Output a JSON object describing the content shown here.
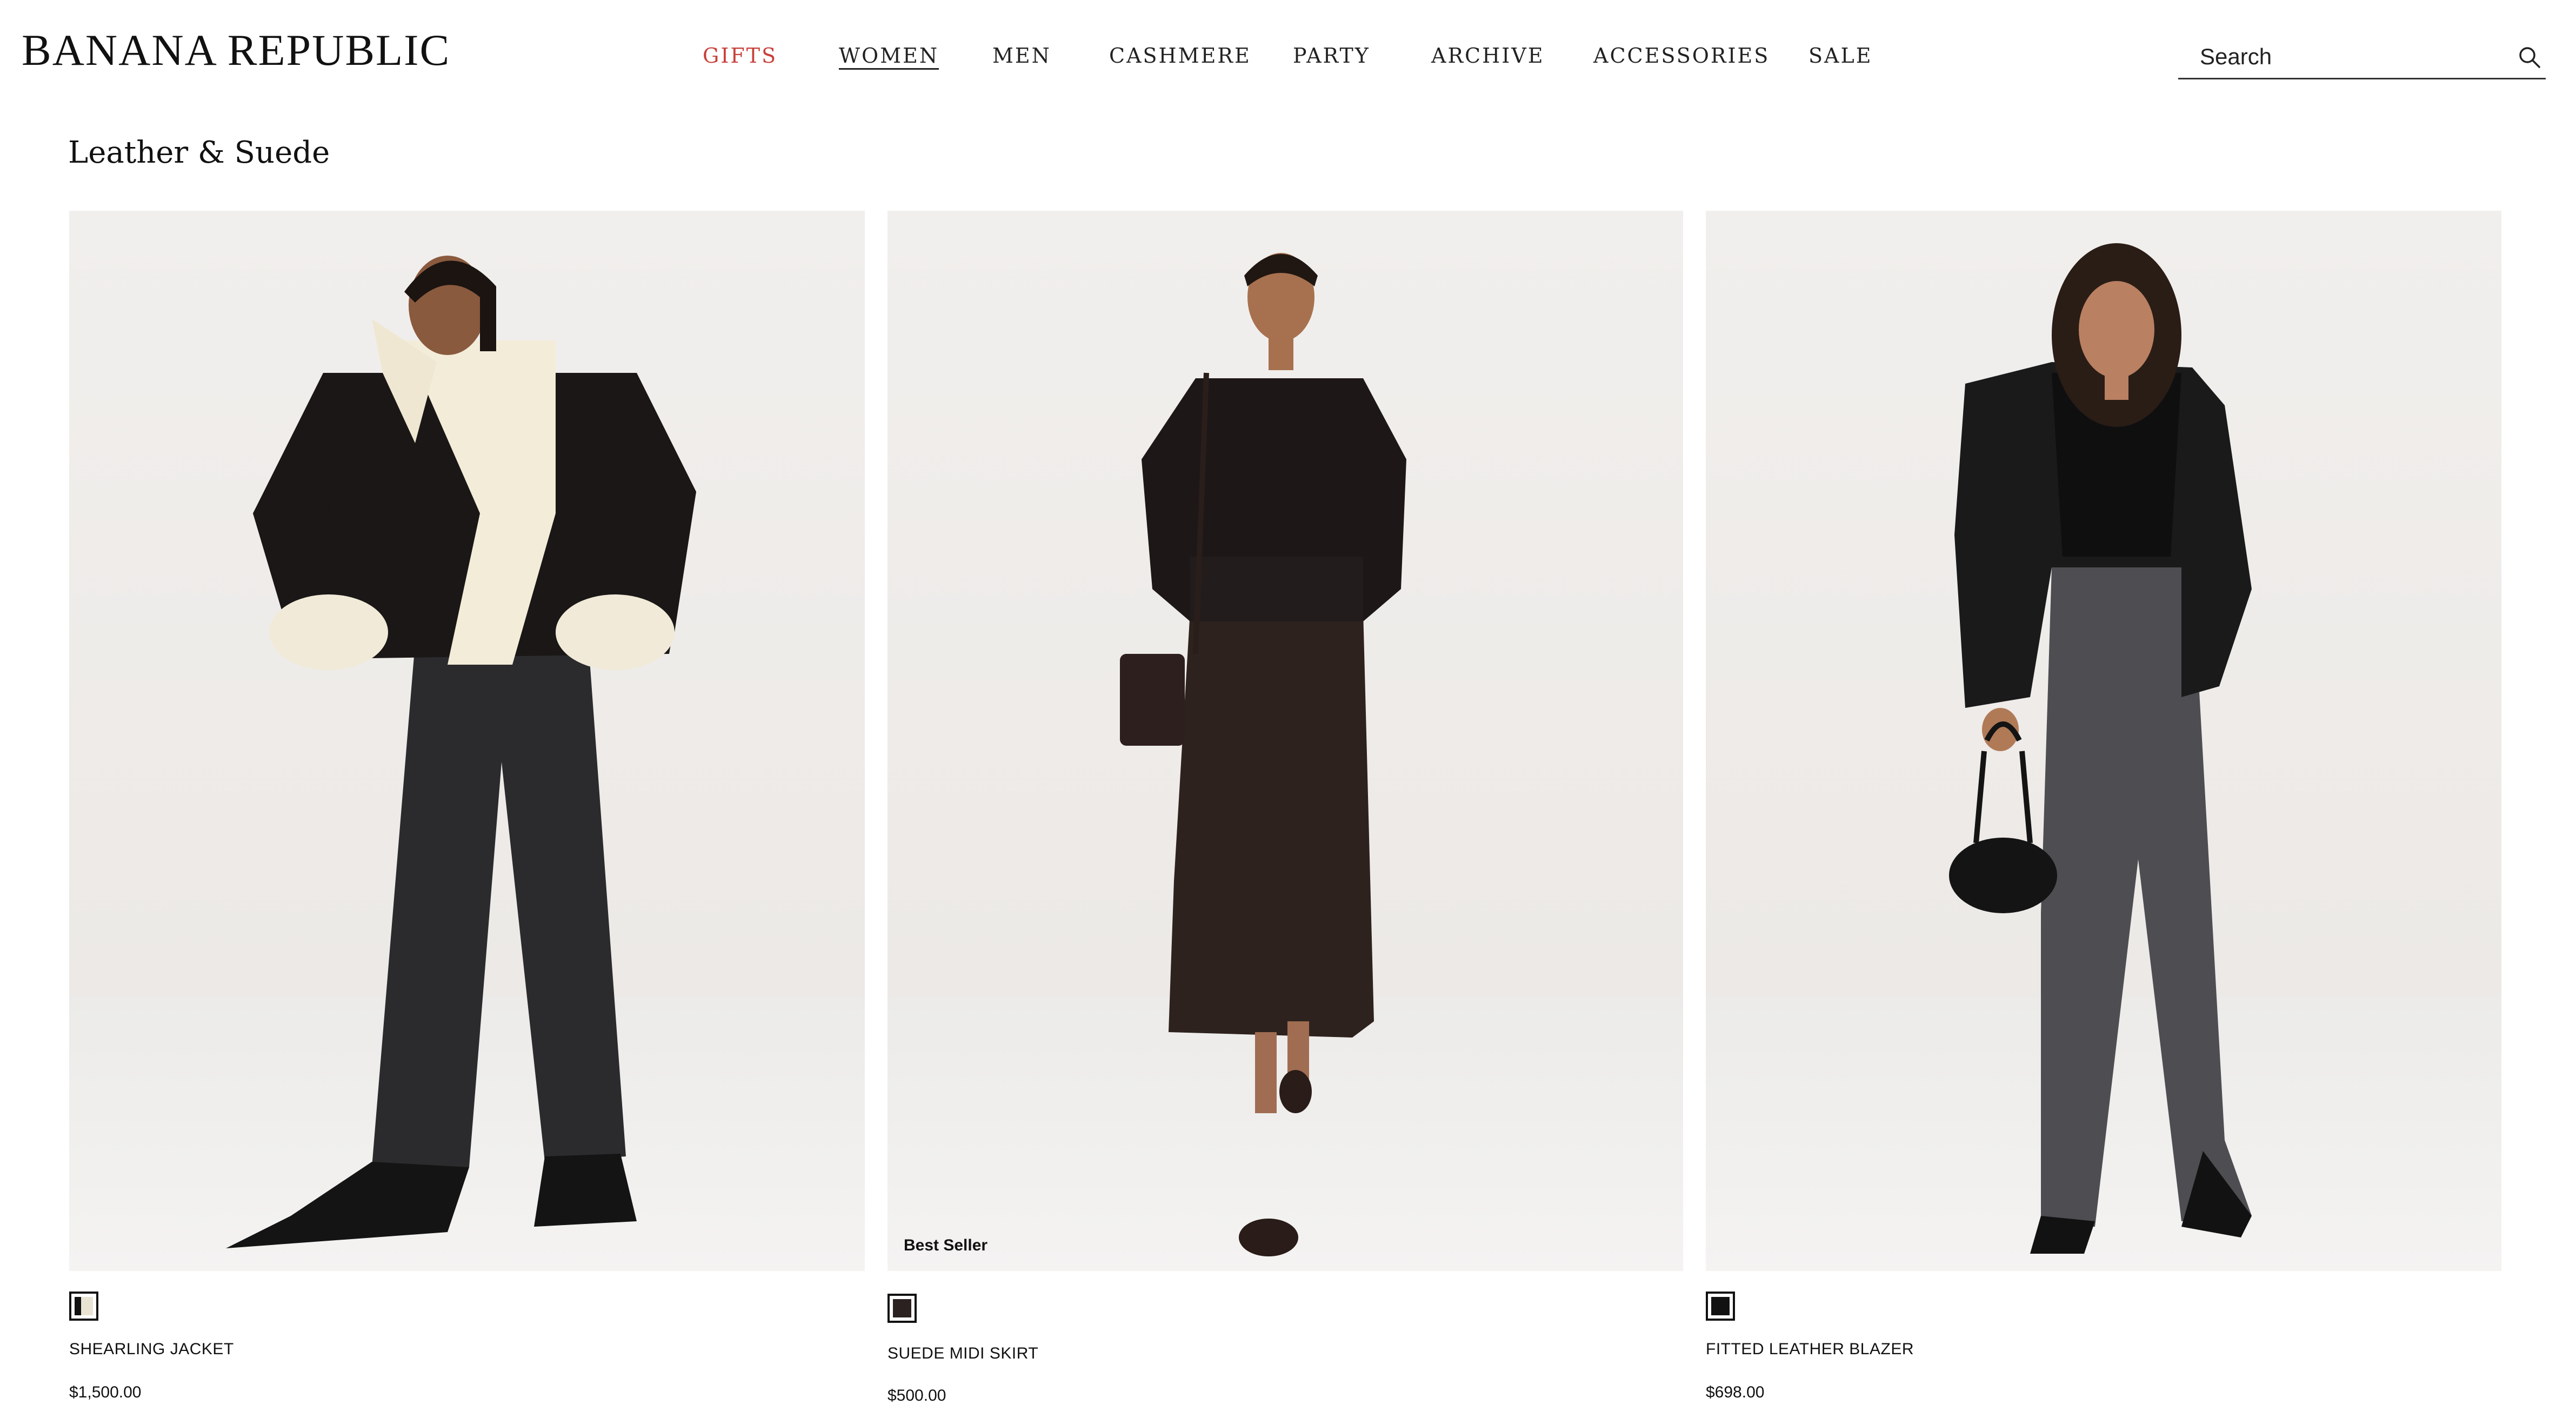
{
  "header": {
    "logo": "BANANA REPUBLIC",
    "nav": [
      {
        "label": "GIFTS"
      },
      {
        "label": "WOMEN"
      },
      {
        "label": "MEN"
      },
      {
        "label": "CASHMERE"
      },
      {
        "label": "PARTY"
      },
      {
        "label": "ARCHIVE"
      },
      {
        "label": "ACCESSORIES"
      },
      {
        "label": "SALE"
      }
    ],
    "search": {
      "placeholder": "Search",
      "icon": "search-icon"
    }
  },
  "page": {
    "title": "Leather & Suede"
  },
  "colors": {
    "gifts": "#c8403a",
    "text": "#111111",
    "background": "#ffffff"
  },
  "products": [
    {
      "name": "SHEARLING JACKET",
      "price": "$1,500.00",
      "badge": "",
      "swatch_color": "#e9e3d3"
    },
    {
      "name": "SUEDE MIDI SKIRT",
      "price": "$500.00",
      "badge": "Best Seller",
      "swatch_color": "#2b2120"
    },
    {
      "name": "FITTED LEATHER BLAZER",
      "price": "$698.00",
      "badge": "",
      "swatch_color": "#111111"
    }
  ]
}
